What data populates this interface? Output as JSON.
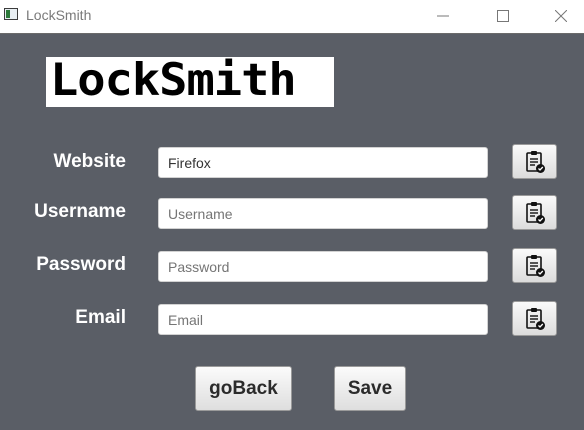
{
  "window": {
    "title": "LockSmith",
    "icons": [
      "app-icon",
      "minimize-icon",
      "maximize-icon",
      "close-icon"
    ]
  },
  "logo": {
    "text": "LockSmith"
  },
  "form": {
    "website": {
      "label": "Website",
      "value": "Firefox",
      "copy_icon": "clipboard-check-icon"
    },
    "username": {
      "label": "Username",
      "placeholder": "Username",
      "copy_icon": "clipboard-check-icon"
    },
    "password": {
      "label": "Password",
      "placeholder": "Password",
      "copy_icon": "clipboard-check-icon"
    },
    "email": {
      "label": "Email",
      "placeholder": "Email",
      "copy_icon": "clipboard-check-icon"
    }
  },
  "actions": {
    "back_label": "goBack",
    "save_label": "Save"
  },
  "colors": {
    "background": "#5a5e66",
    "titlebar": "#ffffff",
    "label": "#ffffff"
  }
}
